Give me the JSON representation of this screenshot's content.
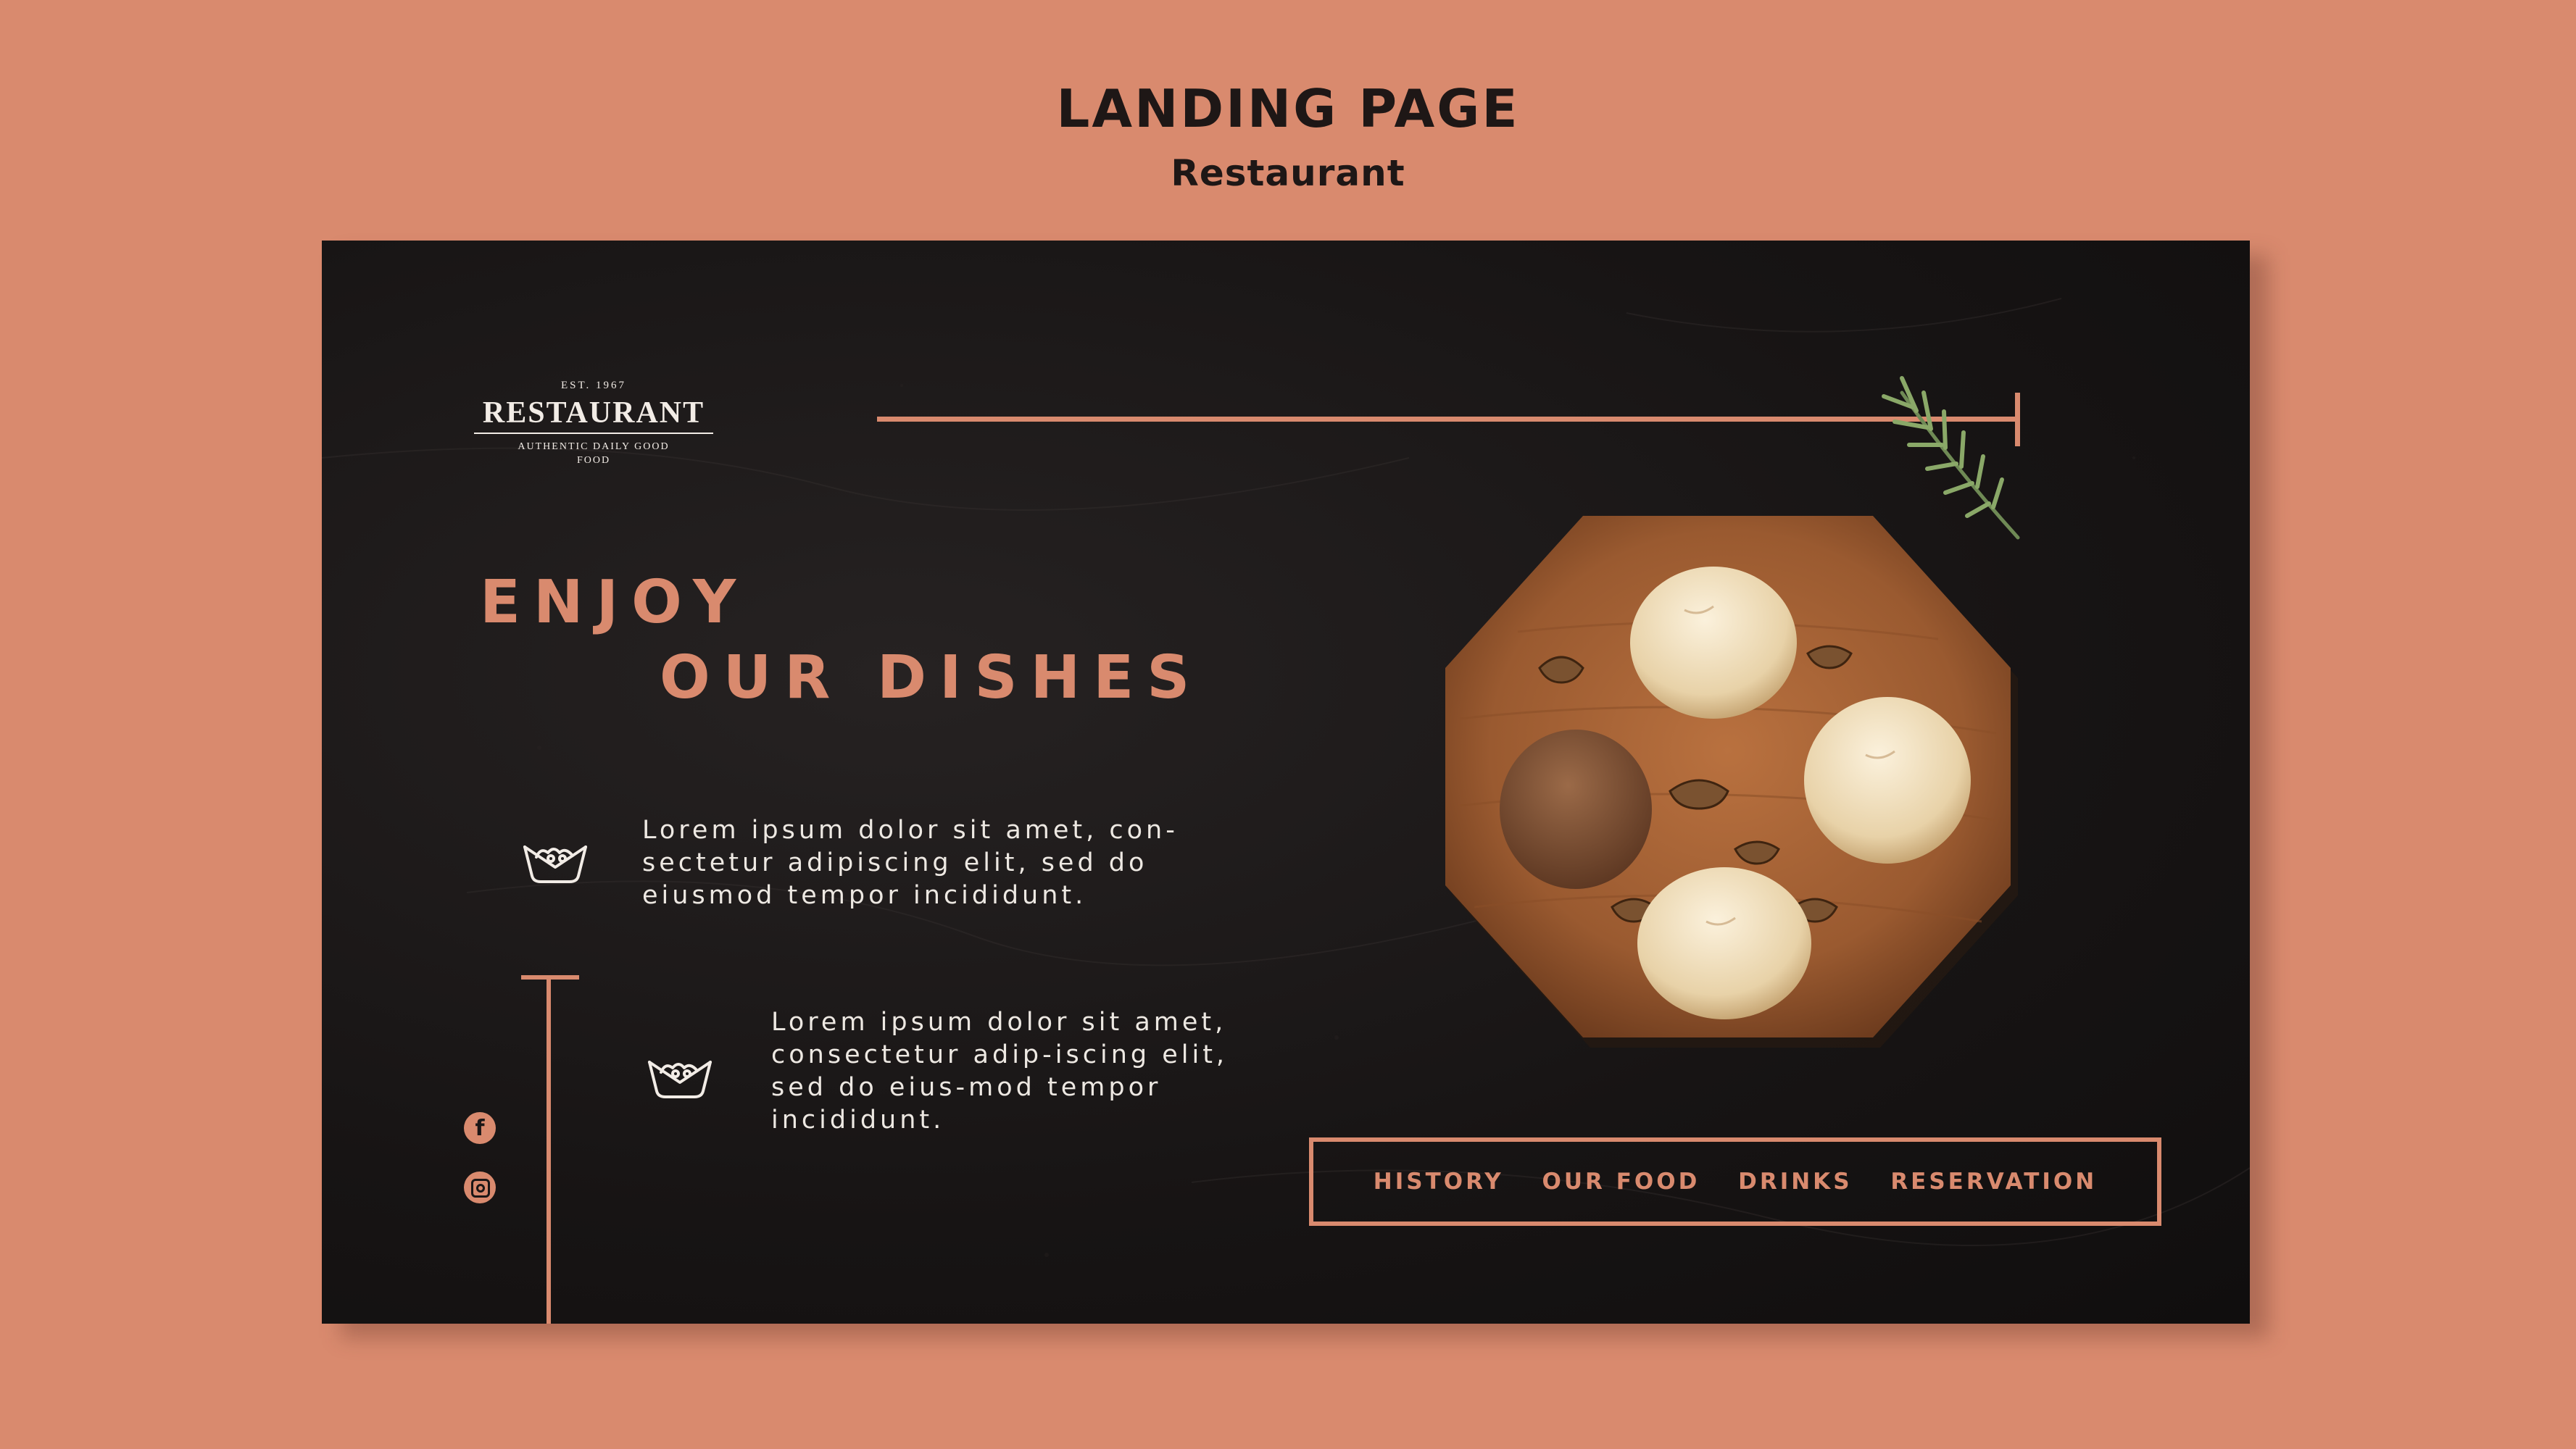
{
  "page": {
    "title": "LANDING PAGE",
    "subtitle": "Restaurant"
  },
  "logo": {
    "est": "EST. 1967",
    "name": "RESTAURANT",
    "tagline_1": "AUTHENTIC DAILY GOOD",
    "tagline_2": "FOOD"
  },
  "hero": {
    "headline_1": "ENJOY",
    "headline_2": "OUR DISHES"
  },
  "features": [
    {
      "icon": "salad-bowl-icon",
      "text": "Lorem ipsum dolor sit amet, con-sectetur adipiscing elit, sed do eiusmod tempor incididunt."
    },
    {
      "icon": "salad-bowl-icon",
      "text": "Lorem ipsum dolor sit amet, consectetur adip-iscing elit, sed do eius-mod tempor incididunt."
    }
  ],
  "social": {
    "facebook_icon": "facebook-icon",
    "facebook_glyph": "f",
    "instagram_icon": "instagram-icon"
  },
  "nav": {
    "items": [
      "HISTORY",
      "OUR FOOD",
      "DRINKS",
      "RESERVATION"
    ]
  },
  "colors": {
    "background": "#D98A6E",
    "card": "#171414",
    "accent": "#D98A6E",
    "text_light": "#EDE8E2",
    "heading_dark": "#1E1716"
  }
}
